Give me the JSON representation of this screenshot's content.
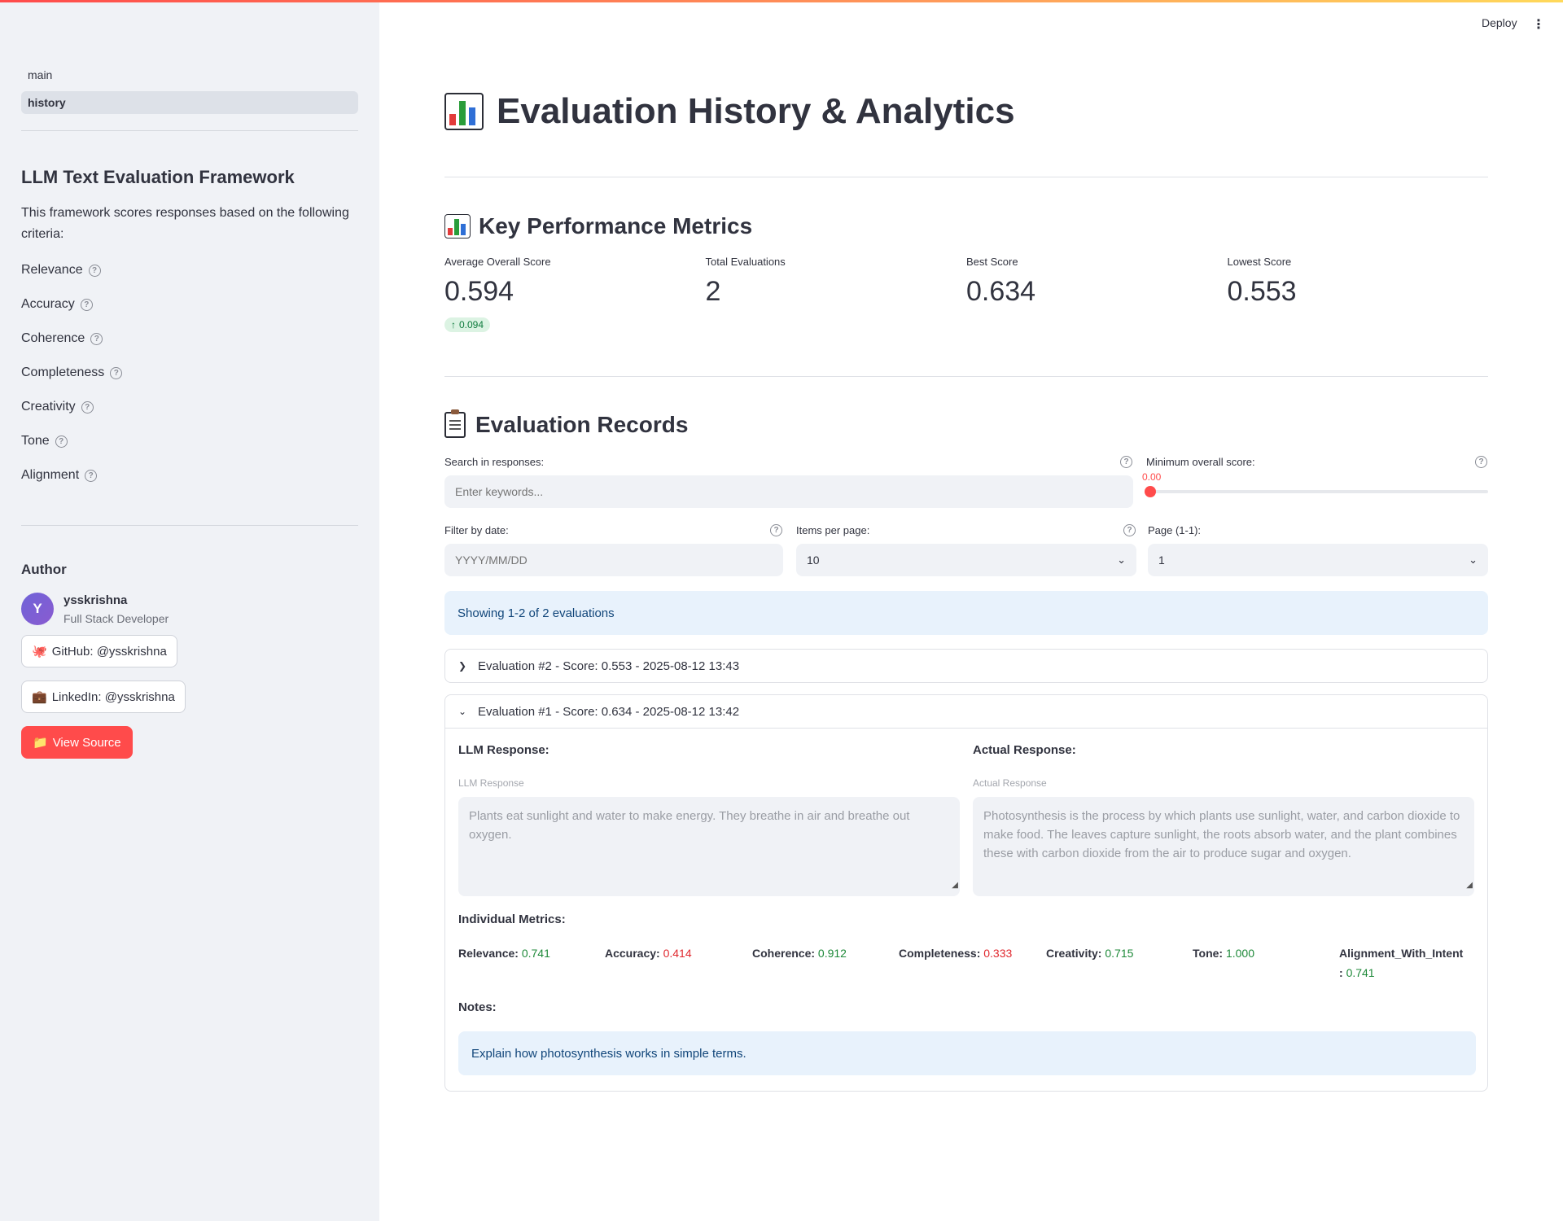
{
  "header": {
    "deploy_label": "Deploy",
    "menu_glyph": "⋮"
  },
  "sidebar": {
    "nav": [
      {
        "label": "main",
        "active": false
      },
      {
        "label": "history",
        "active": true
      }
    ],
    "title": "LLM Text Evaluation Framework",
    "description": "This framework scores responses based on the following criteria:",
    "criteria": [
      "Relevance",
      "Accuracy",
      "Coherence",
      "Completeness",
      "Creativity",
      "Tone",
      "Alignment"
    ],
    "author_heading": "Author",
    "author": {
      "initial": "Y",
      "name": "ysskrishna",
      "role": "Full Stack Developer"
    },
    "links": {
      "github": {
        "icon": "🐙",
        "label": "GitHub: @ysskrishna"
      },
      "linkedin": {
        "icon": "💼",
        "label": "LinkedIn: @ysskrishna"
      },
      "source": {
        "icon": "📁",
        "label": "View Source"
      }
    }
  },
  "main": {
    "title": "Evaluation History & Analytics",
    "kpi_title": "Key Performance Metrics",
    "kpis": [
      {
        "label": "Average Overall Score",
        "value": "0.594",
        "delta": "0.094"
      },
      {
        "label": "Total Evaluations",
        "value": "2"
      },
      {
        "label": "Best Score",
        "value": "0.634"
      },
      {
        "label": "Lowest Score",
        "value": "0.553"
      }
    ],
    "records_title": "Evaluation Records",
    "filters": {
      "search_label": "Search in responses:",
      "search_placeholder": "Enter keywords...",
      "min_score_label": "Minimum overall score:",
      "min_score_value": "0.00",
      "min_score_fraction": 0,
      "date_label": "Filter by date:",
      "date_placeholder": "YYYY/MM/DD",
      "items_label": "Items per page:",
      "items_value": "10",
      "page_label": "Page (1-1):",
      "page_value": "1"
    },
    "showing_text": "Showing 1-2 of 2 evaluations",
    "evaluations": [
      {
        "header": "Evaluation #2 - Score: 0.553 - 2025-08-12 13:43",
        "expanded": false
      },
      {
        "header": "Evaluation #1 - Score: 0.634 - 2025-08-12 13:42",
        "expanded": true,
        "llm_heading": "LLM Response:",
        "llm_field_label": "LLM Response",
        "llm_text": "Plants eat sunlight and water to make energy. They breathe in air and breathe out oxygen.",
        "actual_heading": "Actual Response:",
        "actual_field_label": "Actual Response",
        "actual_text": "Photosynthesis is the process by which plants use sunlight, water, and carbon dioxide to make food. The leaves capture sunlight, the roots absorb water, and the plant combines these with carbon dioxide from the air to produce sugar and oxygen.",
        "metrics_heading": "Individual Metrics:",
        "metrics": [
          {
            "name": "Relevance:",
            "value": "0.741",
            "status": "good"
          },
          {
            "name": "Accuracy:",
            "value": "0.414",
            "status": "bad"
          },
          {
            "name": "Coherence:",
            "value": "0.912",
            "status": "good"
          },
          {
            "name": "Completeness:",
            "value": "0.333",
            "status": "bad"
          },
          {
            "name": "Creativity:",
            "value": "0.715",
            "status": "good"
          },
          {
            "name": "Tone:",
            "value": "1.000",
            "status": "good"
          },
          {
            "name": "Alignment_With_Intent",
            "name2": ":",
            "value": "0.741",
            "status": "good"
          }
        ],
        "notes_heading": "Notes:",
        "notes_text": "Explain how photosynthesis works in simple terms."
      }
    ]
  },
  "colors": {
    "accent": "#ff4b4b",
    "good": "#1f8a3a",
    "bad": "#e0282e",
    "info_bg": "#e8f2fc"
  }
}
